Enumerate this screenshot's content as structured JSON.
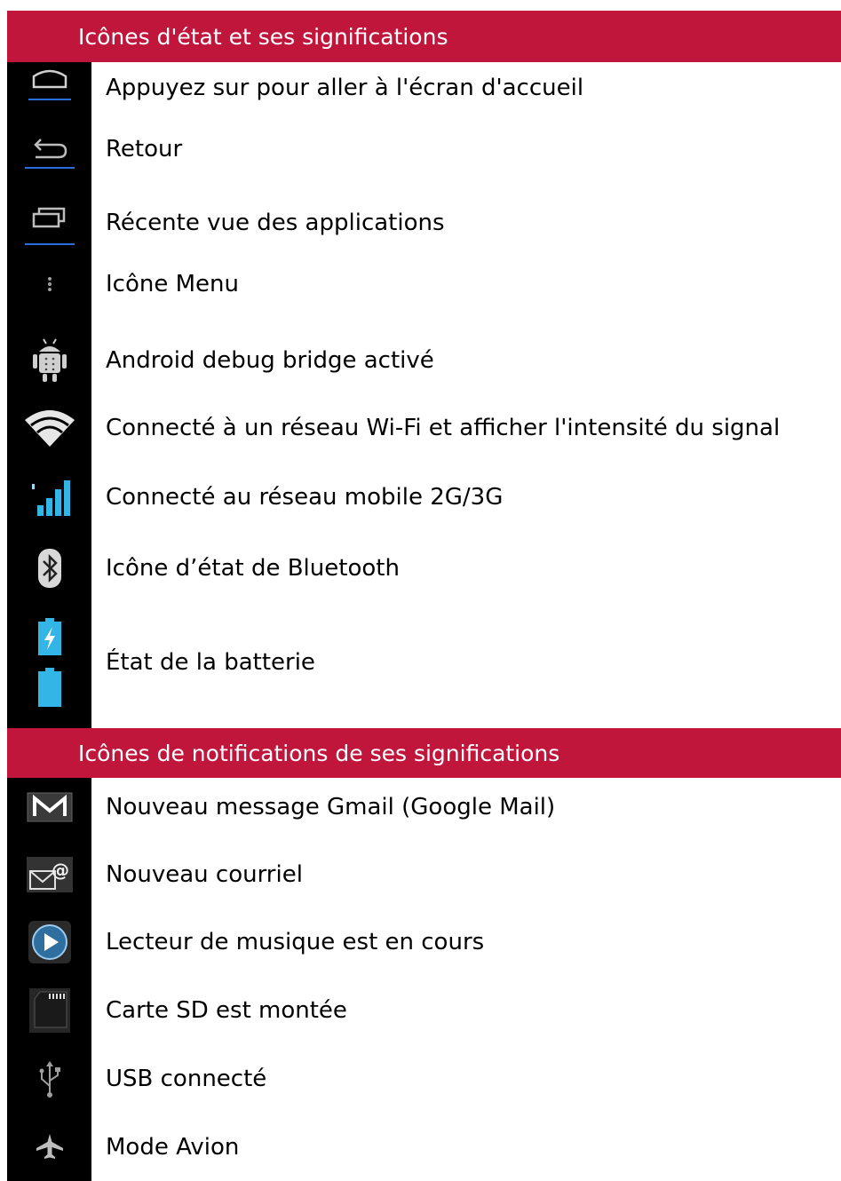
{
  "sections": [
    {
      "title": "Icônes d'état et ses significations",
      "items": [
        {
          "icon": "home-icon",
          "label": "Appuyez sur pour aller à l'écran d'accueil"
        },
        {
          "icon": "back-icon",
          "label": "Retour"
        },
        {
          "icon": "recent-apps-icon",
          "label": "Récente vue des applications"
        },
        {
          "icon": "menu-icon",
          "label": "Icône Menu"
        },
        {
          "icon": "android-debug-icon",
          "label": "Android debug bridge activé"
        },
        {
          "icon": "wifi-icon",
          "label": "Connecté à un réseau Wi-Fi et afficher l'intensité du signal"
        },
        {
          "icon": "signal-bars-icon",
          "label": "Connecté au réseau mobile 2G/3G"
        },
        {
          "icon": "bluetooth-icon",
          "label": "Icône d’état de Bluetooth"
        },
        {
          "icon": "battery-icon",
          "label": "État de la batterie"
        }
      ]
    },
    {
      "title": "Icônes de notifications de ses significations",
      "items": [
        {
          "icon": "gmail-icon",
          "label": "Nouveau message Gmail (Google Mail)"
        },
        {
          "icon": "email-icon",
          "label": "Nouveau courriel"
        },
        {
          "icon": "music-play-icon",
          "label": "Lecteur de musique est en cours"
        },
        {
          "icon": "sd-card-icon",
          "label": "Carte SD est montée"
        },
        {
          "icon": "usb-icon",
          "label": "USB connecté"
        },
        {
          "icon": "airplane-icon",
          "label": "Mode Avion"
        }
      ]
    }
  ],
  "colors": {
    "header": "#c0163c",
    "icon_column": "#000000",
    "accent": "#2b6de0"
  }
}
